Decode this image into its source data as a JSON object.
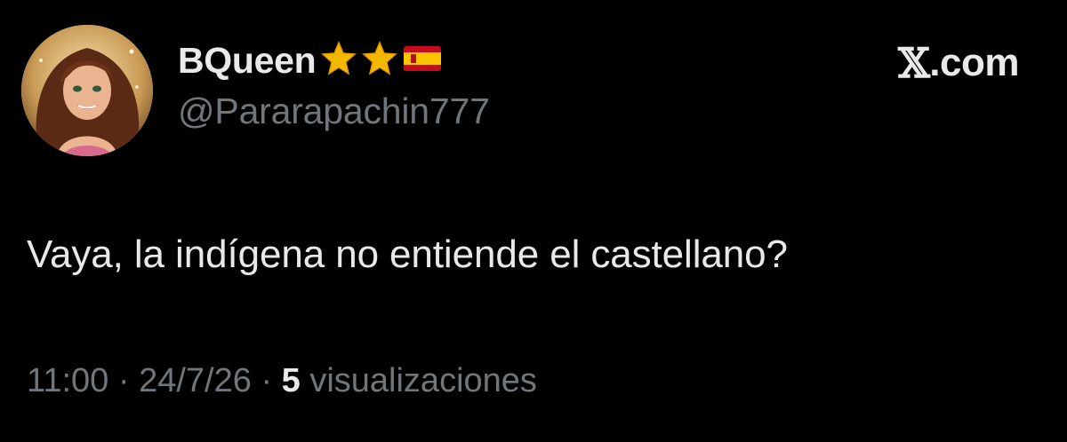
{
  "author": {
    "display_name": "BQueen",
    "badges": [
      "star-icon",
      "star-icon",
      "spain-flag-icon"
    ],
    "handle": "@Pararapachin777"
  },
  "brand": {
    "x_letter": "𝕏",
    "suffix": ".com"
  },
  "tweet": {
    "text": "Vaya, la indígena no entiende el castellano?"
  },
  "meta": {
    "time": "11:00",
    "separator": " · ",
    "date": "24/7/26",
    "views_count": "5",
    "views_label": " visualizaciones"
  },
  "colors": {
    "background": "#000000",
    "primary_text": "#e7e9ea",
    "secondary_text": "#71767b",
    "star": "#f5b800",
    "flag_red": "#c60b1e",
    "flag_yellow": "#ffc400"
  }
}
